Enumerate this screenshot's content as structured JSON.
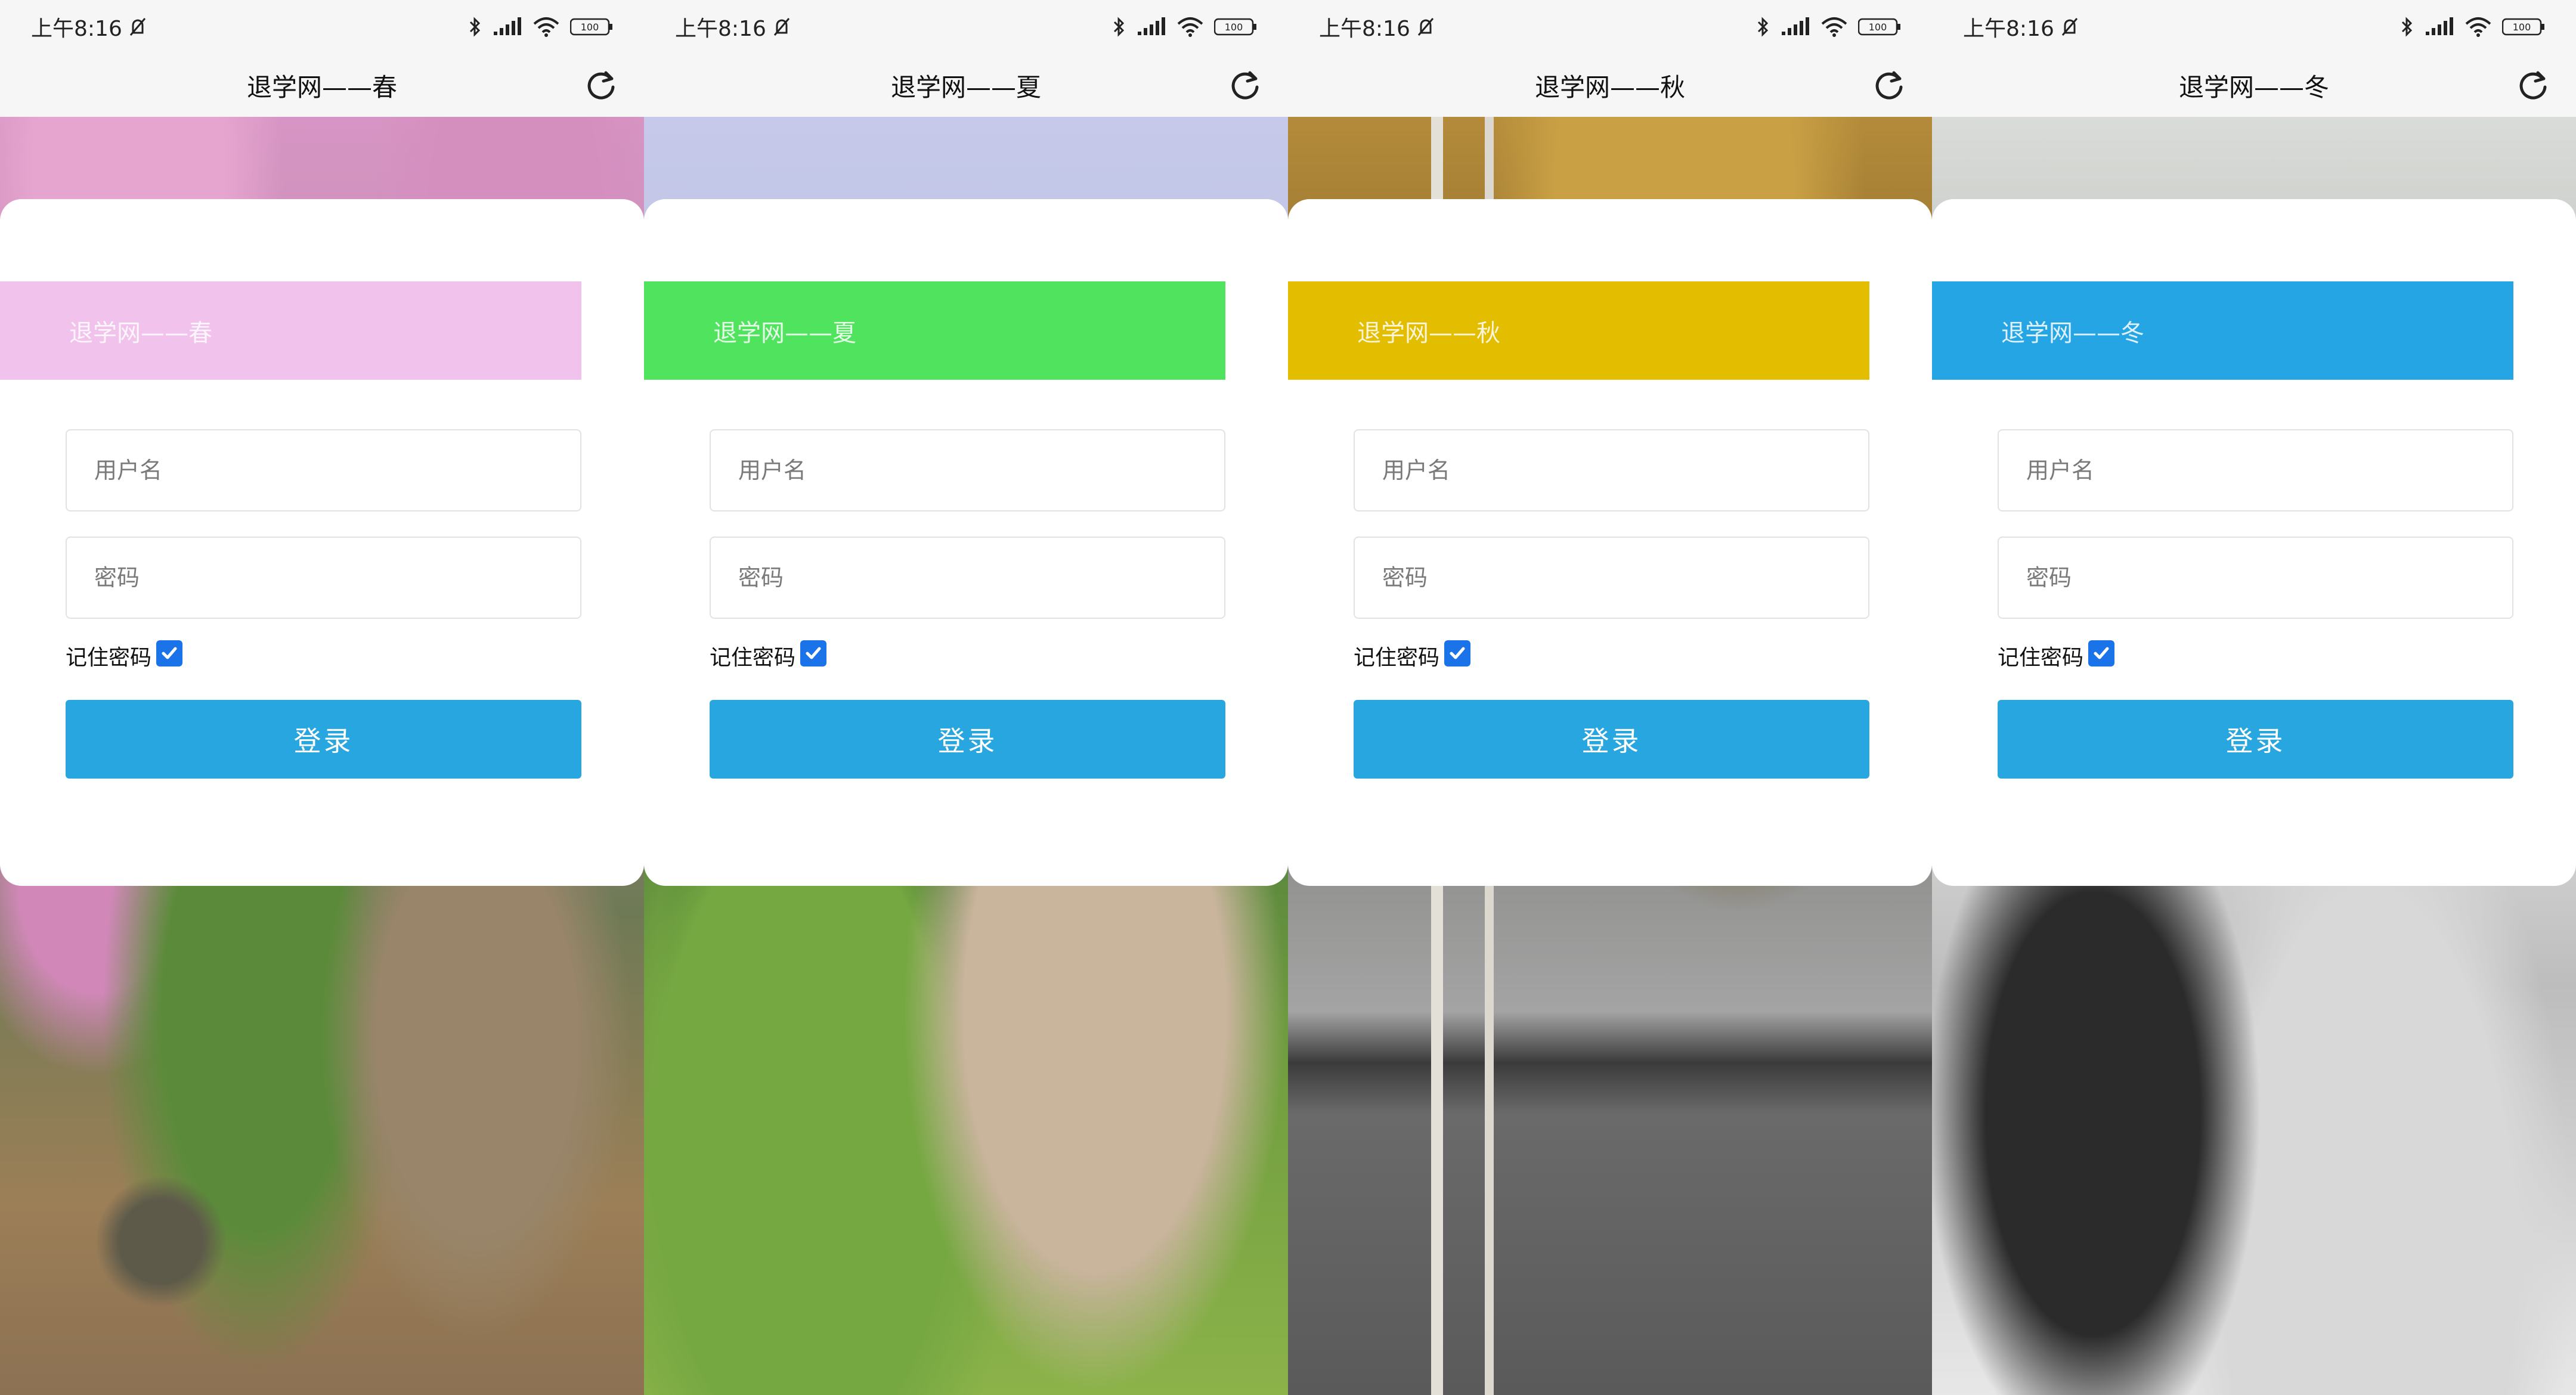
{
  "screens": [
    {
      "status": {
        "time": "上午8:16",
        "battery": "100"
      },
      "title": "退学网——春",
      "banner_text": "退学网——春",
      "banner_color": "#f0c2ec",
      "background": "spring-blossom-photo",
      "form": {
        "username_placeholder": "用户名",
        "password_placeholder": "密码",
        "remember_label": "记住密码",
        "remember_checked": true,
        "login_label": "登录"
      }
    },
    {
      "status": {
        "time": "上午8:16",
        "battery": "100"
      },
      "title": "退学网——夏",
      "banner_text": "退学网——夏",
      "banner_color": "#4fe35e",
      "background": "summer-garden-path-photo",
      "form": {
        "username_placeholder": "用户名",
        "password_placeholder": "密码",
        "remember_label": "记住密码",
        "remember_checked": true,
        "login_label": "登录"
      }
    },
    {
      "status": {
        "time": "上午8:16",
        "battery": "100"
      },
      "title": "退学网——秋",
      "banner_text": "退学网——秋",
      "banner_color": "#e3bd00",
      "background": "autumn-wall-photo",
      "form": {
        "username_placeholder": "用户名",
        "password_placeholder": "密码",
        "remember_label": "记住密码",
        "remember_checked": true,
        "login_label": "登录"
      }
    },
    {
      "status": {
        "time": "上午8:16",
        "battery": "100"
      },
      "title": "退学网——冬",
      "banner_text": "退学网——冬",
      "banner_color": "#25a5e3",
      "background": "winter-snow-photo",
      "form": {
        "username_placeholder": "用户名",
        "password_placeholder": "密码",
        "remember_label": "记住密码",
        "remember_checked": true,
        "login_label": "登录"
      }
    }
  ],
  "colors": {
    "login_button": "#27a6e0",
    "checkbox": "#1a73e8",
    "bar_background": "#f6f6f6"
  },
  "icons": [
    "mute-icon",
    "bluetooth-icon",
    "signal-icon",
    "wifi-icon",
    "battery-icon",
    "refresh-icon",
    "checkmark-icon"
  ]
}
